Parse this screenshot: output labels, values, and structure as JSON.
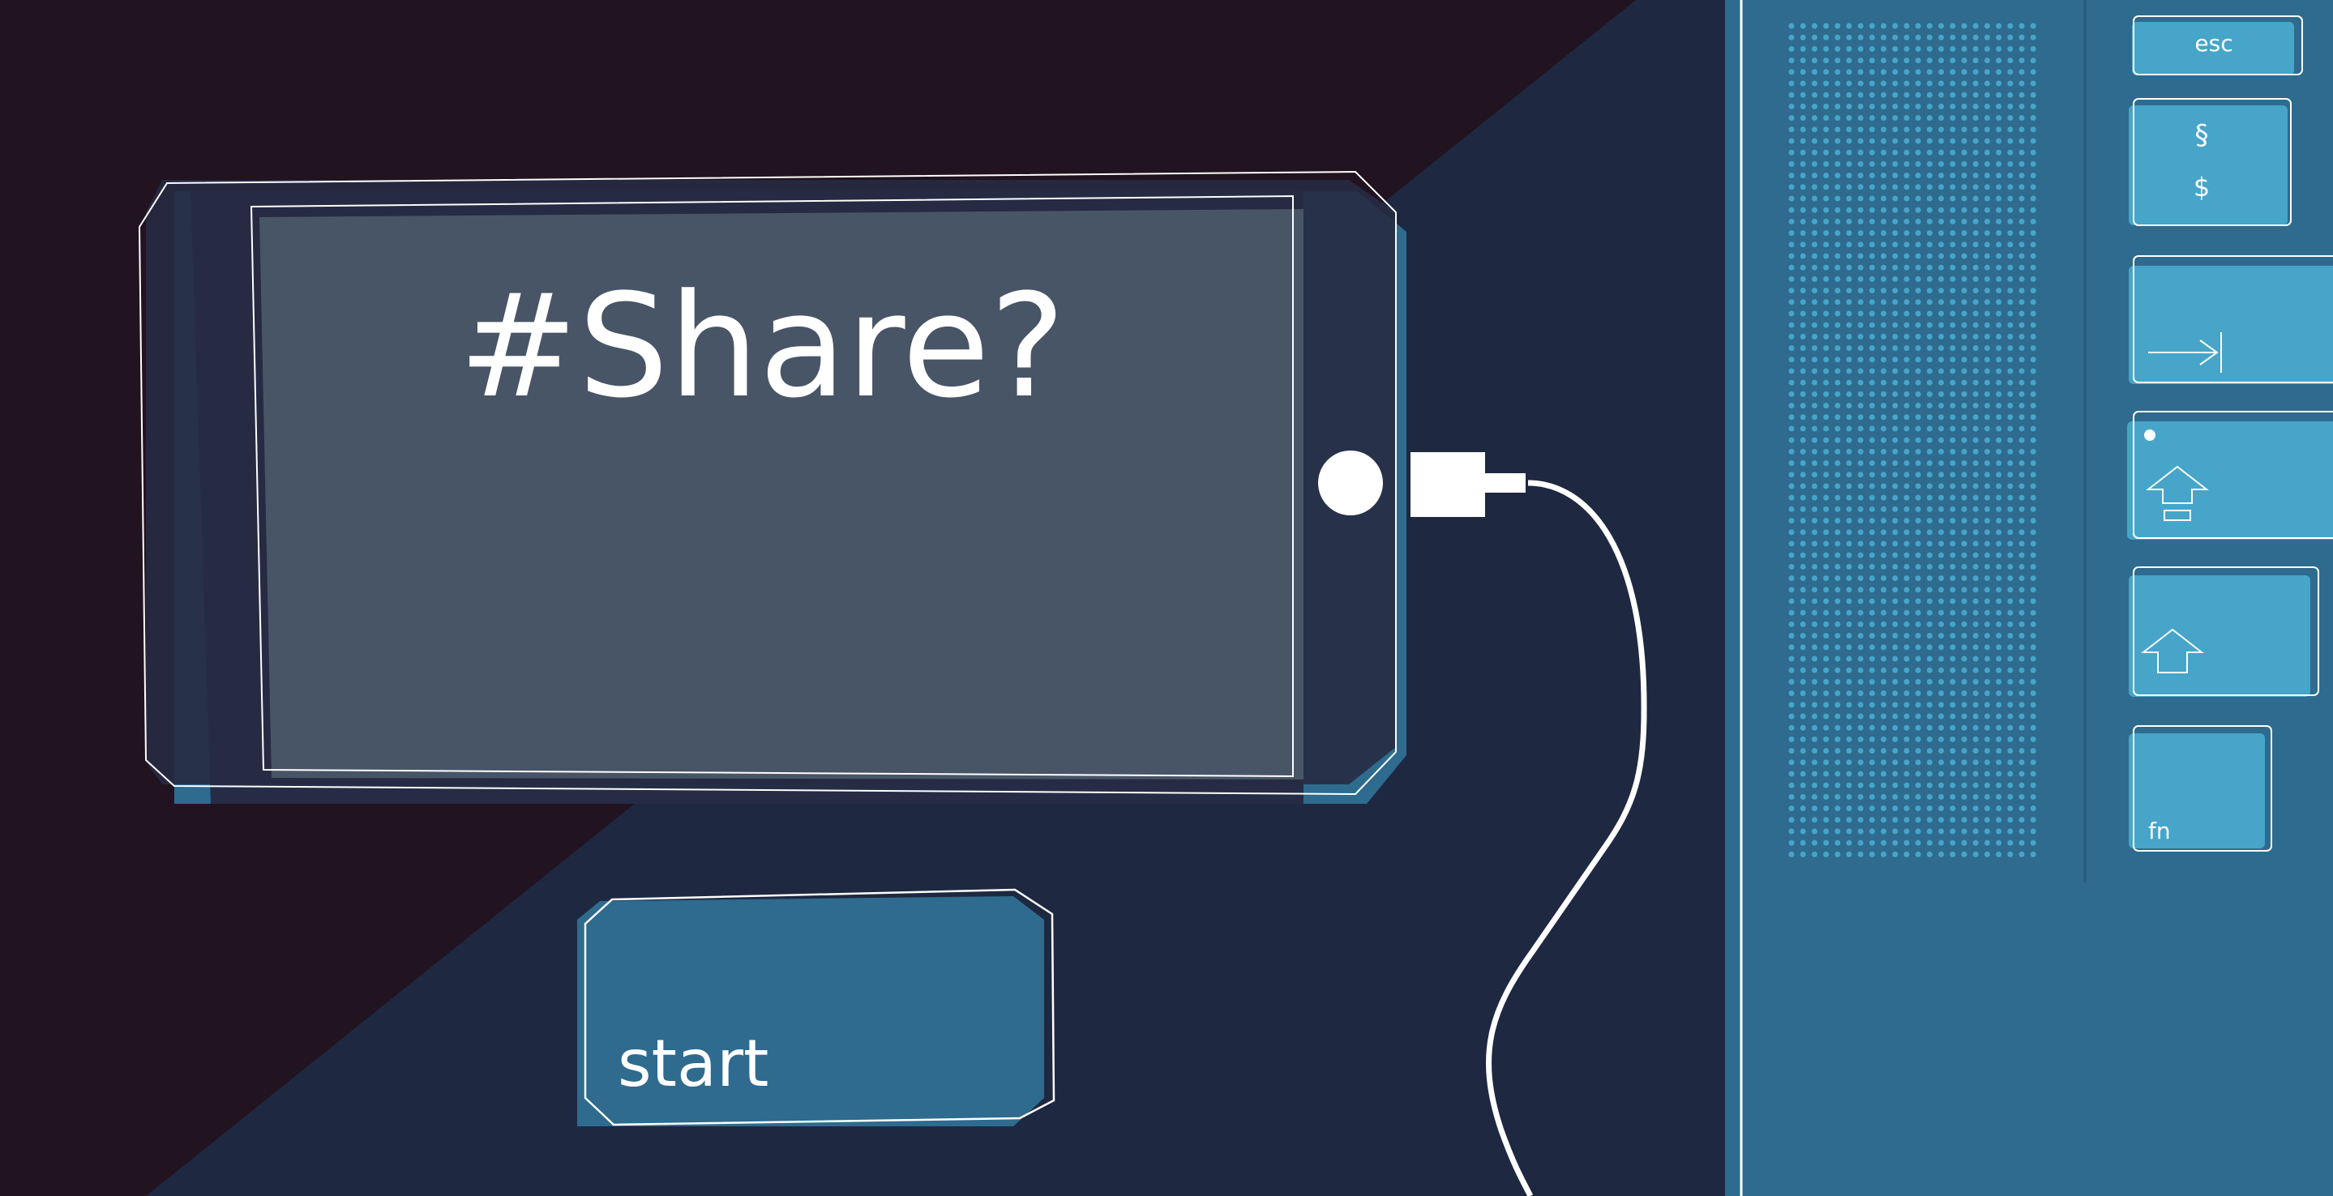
{
  "phone": {
    "screen_text": "#Share?"
  },
  "start_button": {
    "label": "start"
  },
  "keyboard": {
    "keys": {
      "esc": "esc",
      "section": "§",
      "dollar": "$",
      "fn": "fn"
    }
  },
  "colors": {
    "background_dark": "#21131f",
    "background_navy": "#1f2841",
    "accent_blue": "#2e6b8e",
    "key_blue": "#46a5c9",
    "screen_gray": "#485566",
    "line_white": "#ffffff"
  },
  "icons": [
    "tab-arrow-icon",
    "caps-lock-icon",
    "shift-arrow-icon",
    "home-button-icon",
    "usb-plug-icon"
  ]
}
